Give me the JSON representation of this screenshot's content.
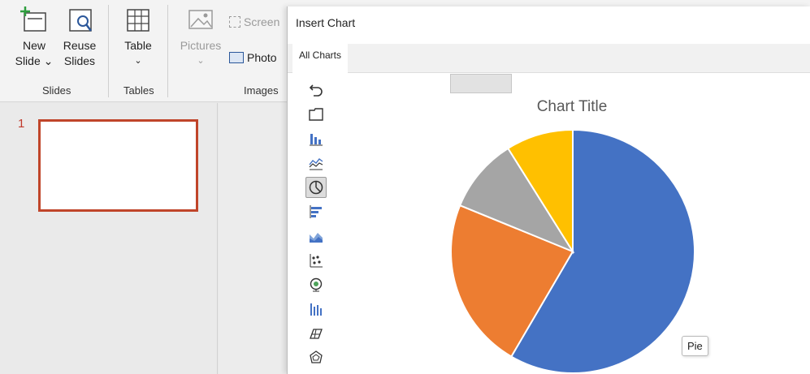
{
  "ribbon": {
    "slides_group": {
      "new_slide_line1": "New",
      "new_slide_line2": "Slide ⌄",
      "reuse_line1": "Reuse",
      "reuse_line2": "Slides",
      "label": "Slides"
    },
    "tables_group": {
      "table_label": "Table",
      "table_chevron": "⌄",
      "label": "Tables"
    },
    "images_group": {
      "pictures_label": "Pictures",
      "pictures_chevron": "⌄",
      "screenshot_label": "Screen",
      "photo_label": "Photo",
      "label": "Images"
    }
  },
  "thumbnails": {
    "slide_number": "1"
  },
  "dialog": {
    "title": "Insert Chart",
    "tab_all_charts": "All Charts",
    "chart_types": [
      "recent-icon",
      "templates-icon",
      "column-chart-icon",
      "line-chart-icon",
      "pie-chart-icon",
      "bar-chart-icon",
      "area-chart-icon",
      "scatter-chart-icon",
      "map-chart-icon",
      "stock-chart-icon",
      "surface-chart-icon",
      "radar-chart-icon"
    ],
    "selected_type": "pie-chart-icon",
    "tooltip": "Pie"
  },
  "chart_data": {
    "type": "pie",
    "title": "Chart Title",
    "values": [
      59,
      23,
      10,
      9
    ],
    "colors": [
      "#4472c4",
      "#ed7d31",
      "#a5a5a5",
      "#ffc000"
    ]
  }
}
